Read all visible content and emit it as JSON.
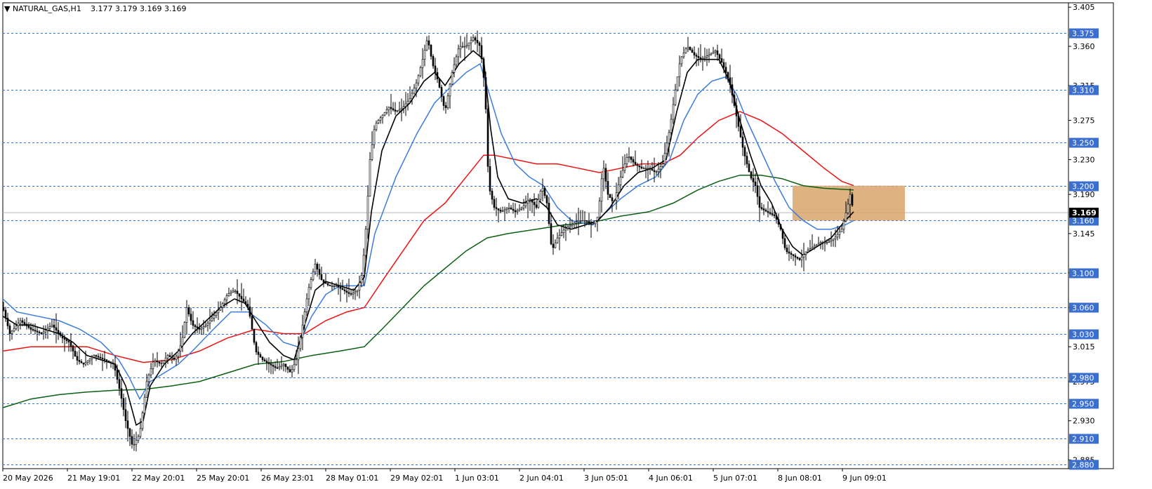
{
  "header": {
    "symbol": "NATURAL_GAS,H1",
    "ohlc": "3.177 3.179 3.169 3.169"
  },
  "colors": {
    "background": "#ffffff",
    "level_line": "#3a6fd0",
    "level_label_bg": "#3a6fd0",
    "price_label_bg": "#000000",
    "zone_fill": "#d9a56c",
    "ma_fast": "#000000",
    "ma_mid": "#3a7bdc",
    "ma_slow": "#ee1111",
    "ma_long": "#0b5e12",
    "candle": "#000000"
  },
  "chart_data": {
    "type": "candlestick",
    "title": "NATURAL_GAS,H1",
    "ylim": [
      2.875,
      3.41
    ],
    "y_tick_labels": [
      "3.405",
      "3.360",
      "3.315",
      "3.275",
      "3.230",
      "3.190",
      "3.145",
      "3.100",
      "3.060",
      "3.015",
      "2.975",
      "2.930",
      "2.885"
    ],
    "x_tick_labels": [
      "20 May 2026",
      "21 May 19:01",
      "22 May 20:01",
      "25 May 20:01",
      "26 May 23:01",
      "28 May 01:01",
      "29 May 02:01",
      "1 Jun 03:01",
      "2 Jun 04:01",
      "3 Jun 05:01",
      "4 Jun 06:01",
      "5 Jun 07:01",
      "8 Jun 08:01",
      "9 Jun 09:01"
    ],
    "horizontal_levels": [
      "3.375",
      "3.310",
      "3.250",
      "3.200",
      "3.160",
      "3.100",
      "3.060",
      "3.030",
      "2.980",
      "2.950",
      "2.910",
      "2.880"
    ],
    "current_price": "3.169",
    "zone": {
      "y_top": 3.2,
      "y_bottom": 3.16
    },
    "price_path": [
      [
        0,
        3.06
      ],
      [
        10,
        3.03
      ],
      [
        25,
        3.045
      ],
      [
        40,
        3.035
      ],
      [
        55,
        3.03
      ],
      [
        70,
        3.04
      ],
      [
        85,
        3.025
      ],
      [
        95,
        3.02
      ],
      [
        105,
        3.0
      ],
      [
        115,
        2.995
      ],
      [
        130,
        3.005
      ],
      [
        145,
        3.0
      ],
      [
        158,
        2.995
      ],
      [
        168,
        2.96
      ],
      [
        175,
        2.93
      ],
      [
        185,
        2.9
      ],
      [
        195,
        2.915
      ],
      [
        205,
        2.975
      ],
      [
        215,
        3.0
      ],
      [
        225,
        2.995
      ],
      [
        235,
        3.005
      ],
      [
        245,
        3.0
      ],
      [
        255,
        3.02
      ],
      [
        262,
        3.06
      ],
      [
        270,
        3.04
      ],
      [
        280,
        3.035
      ],
      [
        290,
        3.04
      ],
      [
        300,
        3.05
      ],
      [
        310,
        3.06
      ],
      [
        320,
        3.075
      ],
      [
        330,
        3.08
      ],
      [
        340,
        3.07
      ],
      [
        350,
        3.06
      ],
      [
        360,
        3.01
      ],
      [
        370,
        3.0
      ],
      [
        380,
        2.995
      ],
      [
        390,
        2.99
      ],
      [
        400,
        2.995
      ],
      [
        410,
        2.985
      ],
      [
        418,
        3.0
      ],
      [
        425,
        3.03
      ],
      [
        435,
        3.08
      ],
      [
        445,
        3.11
      ],
      [
        455,
        3.09
      ],
      [
        465,
        3.085
      ],
      [
        475,
        3.085
      ],
      [
        485,
        3.08
      ],
      [
        495,
        3.075
      ],
      [
        505,
        3.08
      ],
      [
        512,
        3.1
      ],
      [
        518,
        3.16
      ],
      [
        523,
        3.23
      ],
      [
        530,
        3.27
      ],
      [
        540,
        3.28
      ],
      [
        550,
        3.29
      ],
      [
        560,
        3.285
      ],
      [
        570,
        3.29
      ],
      [
        580,
        3.3
      ],
      [
        590,
        3.32
      ],
      [
        598,
        3.345
      ],
      [
        605,
        3.37
      ],
      [
        612,
        3.34
      ],
      [
        620,
        3.32
      ],
      [
        630,
        3.285
      ],
      [
        640,
        3.33
      ],
      [
        650,
        3.36
      ],
      [
        660,
        3.36
      ],
      [
        670,
        3.37
      ],
      [
        680,
        3.36
      ],
      [
        687,
        3.31
      ],
      [
        692,
        3.2
      ],
      [
        700,
        3.175
      ],
      [
        710,
        3.17
      ],
      [
        720,
        3.175
      ],
      [
        730,
        3.17
      ],
      [
        740,
        3.175
      ],
      [
        750,
        3.185
      ],
      [
        760,
        3.175
      ],
      [
        768,
        3.2
      ],
      [
        775,
        3.18
      ],
      [
        782,
        3.125
      ],
      [
        790,
        3.14
      ],
      [
        800,
        3.15
      ],
      [
        810,
        3.155
      ],
      [
        820,
        3.16
      ],
      [
        830,
        3.16
      ],
      [
        840,
        3.155
      ],
      [
        848,
        3.165
      ],
      [
        855,
        3.225
      ],
      [
        862,
        3.19
      ],
      [
        870,
        3.18
      ],
      [
        880,
        3.21
      ],
      [
        890,
        3.235
      ],
      [
        900,
        3.225
      ],
      [
        910,
        3.22
      ],
      [
        920,
        3.22
      ],
      [
        930,
        3.215
      ],
      [
        940,
        3.225
      ],
      [
        950,
        3.265
      ],
      [
        958,
        3.31
      ],
      [
        965,
        3.345
      ],
      [
        975,
        3.36
      ],
      [
        985,
        3.35
      ],
      [
        995,
        3.345
      ],
      [
        1005,
        3.35
      ],
      [
        1015,
        3.355
      ],
      [
        1025,
        3.34
      ],
      [
        1035,
        3.32
      ],
      [
        1045,
        3.28
      ],
      [
        1055,
        3.24
      ],
      [
        1065,
        3.21
      ],
      [
        1072,
        3.2
      ],
      [
        1078,
        3.175
      ],
      [
        1088,
        3.17
      ],
      [
        1100,
        3.165
      ],
      [
        1108,
        3.15
      ],
      [
        1115,
        3.125
      ],
      [
        1125,
        3.12
      ],
      [
        1135,
        3.115
      ],
      [
        1145,
        3.125
      ],
      [
        1155,
        3.13
      ],
      [
        1165,
        3.135
      ],
      [
        1175,
        3.135
      ],
      [
        1185,
        3.14
      ],
      [
        1195,
        3.15
      ],
      [
        1203,
        3.175
      ],
      [
        1207,
        3.19
      ],
      [
        1212,
        3.169
      ]
    ],
    "ma_fast_path": [
      [
        0,
        3.05
      ],
      [
        20,
        3.04
      ],
      [
        40,
        3.04
      ],
      [
        60,
        3.035
      ],
      [
        80,
        3.03
      ],
      [
        100,
        3.02
      ],
      [
        120,
        3.005
      ],
      [
        140,
        3.0
      ],
      [
        160,
        2.995
      ],
      [
        175,
        2.97
      ],
      [
        190,
        2.925
      ],
      [
        200,
        2.93
      ],
      [
        210,
        2.97
      ],
      [
        230,
        2.995
      ],
      [
        250,
        3.01
      ],
      [
        270,
        3.03
      ],
      [
        290,
        3.045
      ],
      [
        310,
        3.06
      ],
      [
        330,
        3.07
      ],
      [
        345,
        3.065
      ],
      [
        360,
        3.045
      ],
      [
        380,
        3.02
      ],
      [
        400,
        3.005
      ],
      [
        415,
        3.0
      ],
      [
        430,
        3.04
      ],
      [
        445,
        3.08
      ],
      [
        460,
        3.09
      ],
      [
        480,
        3.085
      ],
      [
        500,
        3.08
      ],
      [
        515,
        3.095
      ],
      [
        525,
        3.17
      ],
      [
        540,
        3.24
      ],
      [
        560,
        3.28
      ],
      [
        580,
        3.295
      ],
      [
        600,
        3.32
      ],
      [
        615,
        3.33
      ],
      [
        630,
        3.315
      ],
      [
        650,
        3.34
      ],
      [
        670,
        3.355
      ],
      [
        685,
        3.345
      ],
      [
        695,
        3.265
      ],
      [
        705,
        3.21
      ],
      [
        720,
        3.185
      ],
      [
        740,
        3.18
      ],
      [
        760,
        3.185
      ],
      [
        775,
        3.175
      ],
      [
        790,
        3.155
      ],
      [
        810,
        3.15
      ],
      [
        830,
        3.155
      ],
      [
        848,
        3.16
      ],
      [
        865,
        3.175
      ],
      [
        885,
        3.2
      ],
      [
        905,
        3.215
      ],
      [
        925,
        3.22
      ],
      [
        945,
        3.23
      ],
      [
        960,
        3.285
      ],
      [
        975,
        3.33
      ],
      [
        990,
        3.345
      ],
      [
        1005,
        3.345
      ],
      [
        1020,
        3.345
      ],
      [
        1035,
        3.32
      ],
      [
        1050,
        3.275
      ],
      [
        1065,
        3.235
      ],
      [
        1080,
        3.2
      ],
      [
        1095,
        3.18
      ],
      [
        1110,
        3.15
      ],
      [
        1125,
        3.13
      ],
      [
        1140,
        3.12
      ],
      [
        1160,
        3.13
      ],
      [
        1180,
        3.14
      ],
      [
        1200,
        3.16
      ],
      [
        1212,
        3.17
      ]
    ],
    "ma_mid_path": [
      [
        0,
        3.07
      ],
      [
        20,
        3.055
      ],
      [
        50,
        3.05
      ],
      [
        80,
        3.045
      ],
      [
        110,
        3.035
      ],
      [
        140,
        3.02
      ],
      [
        165,
        3.0
      ],
      [
        180,
        2.98
      ],
      [
        195,
        2.955
      ],
      [
        210,
        2.975
      ],
      [
        230,
        2.985
      ],
      [
        250,
        2.995
      ],
      [
        270,
        3.01
      ],
      [
        300,
        3.035
      ],
      [
        325,
        3.055
      ],
      [
        350,
        3.055
      ],
      [
        375,
        3.04
      ],
      [
        400,
        3.02
      ],
      [
        420,
        3.015
      ],
      [
        440,
        3.05
      ],
      [
        460,
        3.075
      ],
      [
        480,
        3.085
      ],
      [
        500,
        3.085
      ],
      [
        515,
        3.085
      ],
      [
        530,
        3.145
      ],
      [
        560,
        3.21
      ],
      [
        590,
        3.26
      ],
      [
        615,
        3.295
      ],
      [
        640,
        3.315
      ],
      [
        660,
        3.33
      ],
      [
        680,
        3.34
      ],
      [
        695,
        3.3
      ],
      [
        710,
        3.26
      ],
      [
        730,
        3.225
      ],
      [
        750,
        3.21
      ],
      [
        770,
        3.2
      ],
      [
        790,
        3.175
      ],
      [
        810,
        3.16
      ],
      [
        840,
        3.155
      ],
      [
        860,
        3.17
      ],
      [
        880,
        3.185
      ],
      [
        905,
        3.2
      ],
      [
        930,
        3.21
      ],
      [
        950,
        3.23
      ],
      [
        970,
        3.275
      ],
      [
        990,
        3.305
      ],
      [
        1010,
        3.32
      ],
      [
        1030,
        3.325
      ],
      [
        1045,
        3.305
      ],
      [
        1060,
        3.275
      ],
      [
        1080,
        3.24
      ],
      [
        1100,
        3.205
      ],
      [
        1120,
        3.175
      ],
      [
        1140,
        3.16
      ],
      [
        1160,
        3.15
      ],
      [
        1180,
        3.15
      ],
      [
        1200,
        3.155
      ],
      [
        1212,
        3.16
      ]
    ],
    "ma_slow_path": [
      [
        0,
        3.01
      ],
      [
        40,
        3.015
      ],
      [
        80,
        3.015
      ],
      [
        120,
        3.015
      ],
      [
        160,
        3.005
      ],
      [
        200,
        2.997
      ],
      [
        240,
        3.0
      ],
      [
        280,
        3.01
      ],
      [
        320,
        3.025
      ],
      [
        360,
        3.035
      ],
      [
        400,
        3.03
      ],
      [
        430,
        3.03
      ],
      [
        460,
        3.045
      ],
      [
        490,
        3.055
      ],
      [
        515,
        3.06
      ],
      [
        540,
        3.09
      ],
      [
        570,
        3.125
      ],
      [
        600,
        3.16
      ],
      [
        630,
        3.18
      ],
      [
        660,
        3.21
      ],
      [
        685,
        3.235
      ],
      [
        700,
        3.235
      ],
      [
        730,
        3.23
      ],
      [
        760,
        3.225
      ],
      [
        790,
        3.225
      ],
      [
        820,
        3.22
      ],
      [
        850,
        3.215
      ],
      [
        880,
        3.22
      ],
      [
        910,
        3.225
      ],
      [
        940,
        3.225
      ],
      [
        965,
        3.235
      ],
      [
        990,
        3.255
      ],
      [
        1020,
        3.275
      ],
      [
        1050,
        3.285
      ],
      [
        1080,
        3.275
      ],
      [
        1110,
        3.26
      ],
      [
        1140,
        3.24
      ],
      [
        1170,
        3.22
      ],
      [
        1195,
        3.205
      ],
      [
        1212,
        3.2
      ]
    ],
    "ma_long_path": [
      [
        0,
        2.945
      ],
      [
        40,
        2.955
      ],
      [
        80,
        2.96
      ],
      [
        120,
        2.963
      ],
      [
        160,
        2.965
      ],
      [
        200,
        2.966
      ],
      [
        240,
        2.97
      ],
      [
        280,
        2.975
      ],
      [
        320,
        2.985
      ],
      [
        360,
        2.995
      ],
      [
        400,
        2.998
      ],
      [
        440,
        3.005
      ],
      [
        480,
        3.01
      ],
      [
        515,
        3.015
      ],
      [
        540,
        3.035
      ],
      [
        570,
        3.06
      ],
      [
        600,
        3.085
      ],
      [
        630,
        3.105
      ],
      [
        660,
        3.125
      ],
      [
        690,
        3.14
      ],
      [
        720,
        3.145
      ],
      [
        760,
        3.15
      ],
      [
        800,
        3.155
      ],
      [
        840,
        3.158
      ],
      [
        880,
        3.165
      ],
      [
        920,
        3.17
      ],
      [
        955,
        3.18
      ],
      [
        990,
        3.195
      ],
      [
        1020,
        3.205
      ],
      [
        1050,
        3.212
      ],
      [
        1080,
        3.212
      ],
      [
        1110,
        3.208
      ],
      [
        1140,
        3.2
      ],
      [
        1170,
        3.197
      ],
      [
        1212,
        3.195
      ]
    ]
  }
}
